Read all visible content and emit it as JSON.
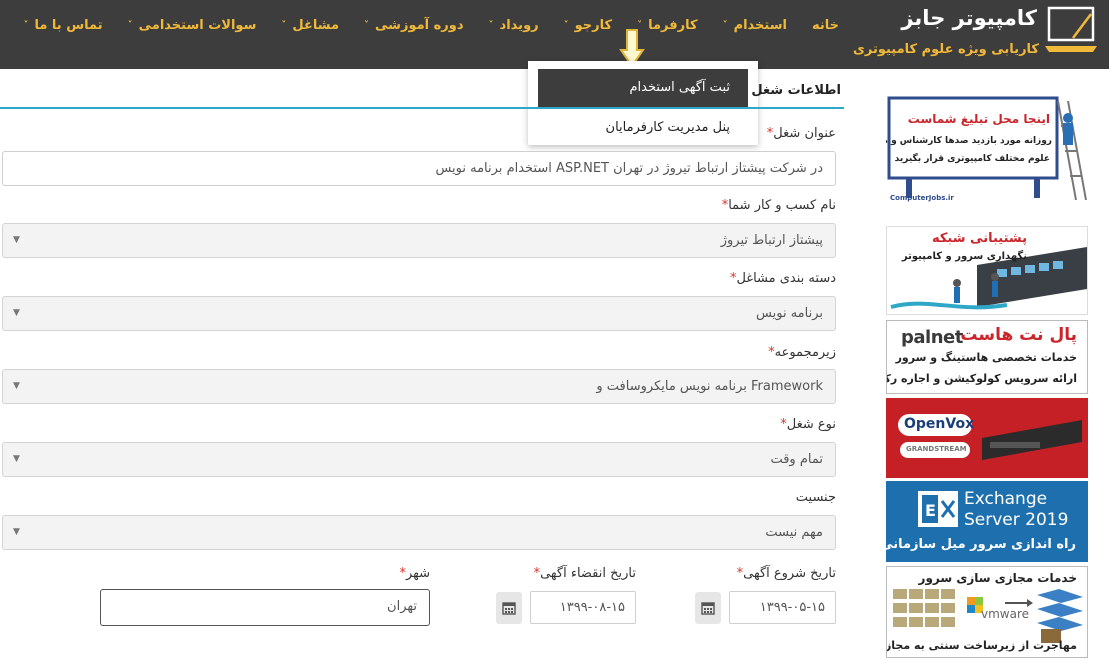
{
  "brand": {
    "title": "کامپیوتر جابز",
    "subtitle": "کاریابی ویژه علوم کامپیوتری"
  },
  "nav": {
    "items": [
      {
        "label": "خانه",
        "has_dropdown": false
      },
      {
        "label": "استخدام",
        "has_dropdown": true
      },
      {
        "label": "کارفرما",
        "has_dropdown": true
      },
      {
        "label": "کارجو",
        "has_dropdown": true
      },
      {
        "label": "رویداد",
        "has_dropdown": true
      },
      {
        "label": "دوره آموزشی",
        "has_dropdown": true
      },
      {
        "label": "مشاغل",
        "has_dropdown": true
      },
      {
        "label": "سوالات استخدامی",
        "has_dropdown": true
      },
      {
        "label": "تماس با ما",
        "has_dropdown": true
      }
    ],
    "chevron": "˅"
  },
  "dropdown": {
    "items": [
      {
        "label": "ثبت آگهی استخدام",
        "active": true
      },
      {
        "label": "پنل مدیریت کارفرمایان",
        "active": false
      }
    ]
  },
  "form": {
    "section_title": "اطلاعات شغل",
    "required_mark": "*",
    "job_title": {
      "label": "عنوان شغل",
      "value": "استخدام برنامه نویس ASP.NET در شرکت پیشتاز ارتباط تیروژ در تهران"
    },
    "business_name": {
      "label": "نام کسب و کار شما",
      "value": "پیشتاز ارتباط تیروژ"
    },
    "job_category": {
      "label": "دسته بندی مشاغل",
      "value": "برنامه نویس"
    },
    "subcategory": {
      "label": "زیرمجموعه",
      "value": "برنامه نویس مایکروسافت و Framework"
    },
    "job_type": {
      "label": "نوع شغل",
      "value": "تمام وقت"
    },
    "gender": {
      "label": "جنسیت",
      "value": "مهم نیست"
    },
    "start_date": {
      "label": "تاریخ شروع آگهی",
      "value": "۱۳۹۹-۰۵-۱۵"
    },
    "expire_date": {
      "label": "تاریخ انقضاء آگهی",
      "value": "۱۳۹۹-۰۸-۱۵"
    },
    "city": {
      "label": "شهر",
      "value": "تهران"
    }
  },
  "ads": {
    "ad1": {
      "title": "اینجا محل تبلیغ شماست",
      "line1": "روزانه مورد بازدید صدها کارشناس و مدیر",
      "line2": "علوم مختلف کامپیوتری قرار بگیرید",
      "footer": "ComputerJobs.ir"
    },
    "ad2": {
      "title": "پشتیبانی شبکه",
      "subtitle": "نگهداری سرور و کامپیوتر"
    },
    "ad3": {
      "brand": "palnet",
      "title": "پال نت هاست",
      "line1": "خدمات تخصصی هاستینگ و سرور",
      "line2": "ارائه سرویس کولوکیشن و اجاره رک"
    },
    "ad4": {
      "brand1": "OpenVox",
      "brand2": "GRANDSTREAM"
    },
    "ad5": {
      "line1": "Exchange",
      "line2": "Server 2019",
      "line3": "راه اندازی سرور میل سازمانی"
    },
    "ad6": {
      "title": "خدمات مجازی سازی سرور",
      "brand": "vmware",
      "footer": "مهاجرت از زیرساخت سنتی به مجازی"
    }
  },
  "colors": {
    "header_bg": "#3d3d3d",
    "accent_gold": "#f0b93a",
    "section_line": "#2fa8c8",
    "required_red": "#d9342b"
  }
}
